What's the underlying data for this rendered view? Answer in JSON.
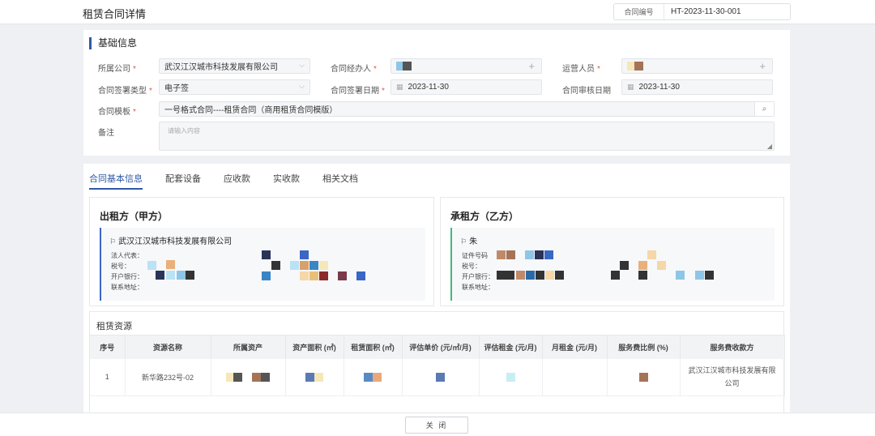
{
  "header": {
    "title": "租赁合同详情",
    "contract_no_label": "合同编号",
    "contract_no_value": "HT-2023-11-30-001"
  },
  "basic": {
    "section_title": "基础信息",
    "company_label": "所属公司",
    "company_value": "武汉江汉城市科技发展有限公司",
    "manager_label": "合同经办人",
    "operator_label": "运营人员",
    "sign_type_label": "合同签署类型",
    "sign_type_value": "电子签",
    "sign_date_label": "合同签署日期",
    "sign_date_value": "2023-11-30",
    "audit_date_label": "合同审核日期",
    "audit_date_value": "2023-11-30",
    "template_label": "合同模板",
    "template_value": "一号格式合同----租赁合同（商用租赁合同模版）",
    "remark_label": "备注",
    "remark_placeholder": "请输入内容"
  },
  "tabs": [
    "合同基本信息",
    "配套设备",
    "应收款",
    "实收款",
    "相关文档"
  ],
  "lessor": {
    "title": "出租方（甲方）",
    "name": "武汉江汉城市科技发展有限公司",
    "rep_label": "法人代表：",
    "tax_label": "税号：",
    "bank_label": "开户银行：",
    "addr_label": "联系地址："
  },
  "lessee": {
    "title": "承租方（乙方）",
    "name": "朱",
    "id_label": "证件号码",
    "tax_label": "税号：",
    "bank_label": "开户银行：",
    "addr_label": "联系地址："
  },
  "resources": {
    "title": "租赁资源",
    "columns": [
      "序号",
      "资源名称",
      "所属资产",
      "资产面积 (㎡)",
      "租赁面积 (㎡)",
      "评估单价 (元/㎡/月)",
      "评估租金 (元/月)",
      "月租金 (元/月)",
      "服务费比例 (%)",
      "服务费收款方"
    ],
    "rows": [
      {
        "index": "1",
        "name": "新华路232号-02",
        "payee": "武汉江汉城市科技发展有限公司"
      }
    ]
  },
  "footer": {
    "close_label": "关 闭"
  },
  "colors": {
    "accent": "#2f5aa8",
    "required": "#e05656",
    "lessee_accent": "#3dbb7f"
  }
}
